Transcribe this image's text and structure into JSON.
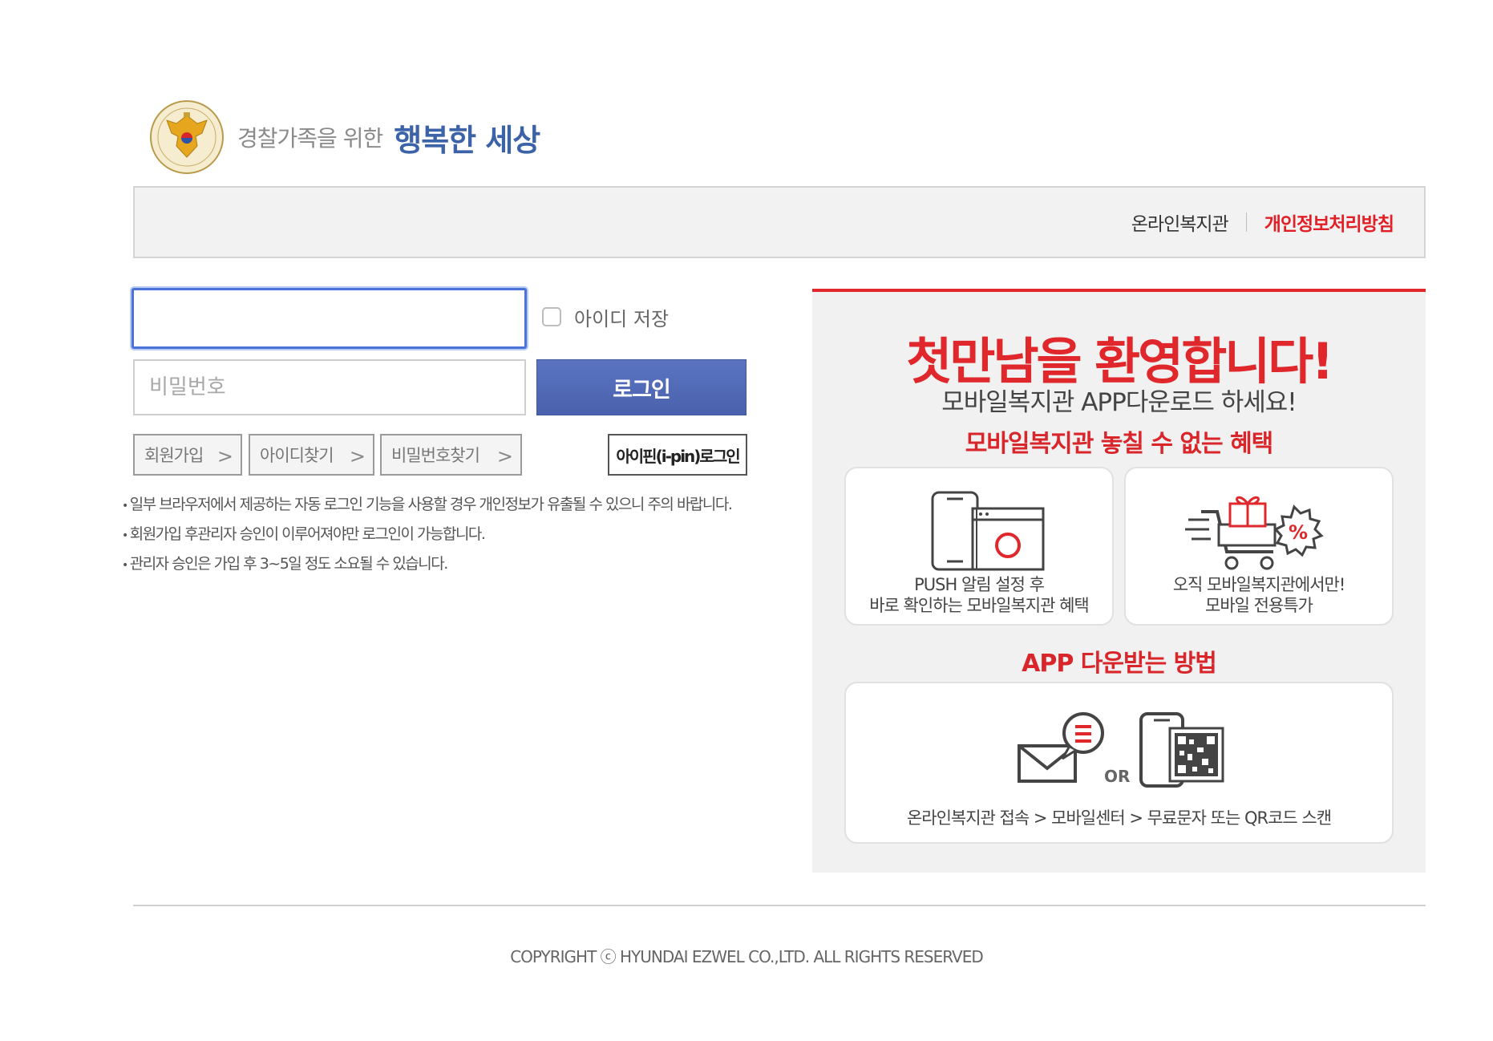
{
  "header": {
    "logo_subtitle": "경찰가족을 위한",
    "logo_title": "행복한 세상"
  },
  "topbar": {
    "link_online": "온라인복지관",
    "link_privacy": "개인정보처리방침"
  },
  "login": {
    "id_value": "",
    "save_id_label": "아이디 저장",
    "password_placeholder": "비밀번호",
    "login_button": "로그인",
    "signup_button": "회원가입",
    "find_id_button": "아이디찾기",
    "find_pw_button": "비밀번호찾기",
    "ipin_button": "아이핀(i-pin)로그인",
    "notices": [
      "일부 브라우저에서 제공하는 자동 로그인 기능을 사용할 경우 개인정보가 유출될 수 있으니 주의 바랍니다.",
      "회원가입 후관리자 승인이 이루어져야만 로그인이 가능합니다.",
      "관리자 승인은 가입 후 3~5일 정도 소요될 수 있습니다."
    ]
  },
  "promo": {
    "title": "첫만남을 환영합니다!",
    "subtitle": "모바일복지관 APP다운로드 하세요!",
    "benefits_heading": "모바일복지관 놓칠 수 없는 혜택",
    "card1_line1": "PUSH 알림 설정 후",
    "card1_line2": "바로 확인하는 모바일복지관 혜택",
    "card2_line1": "오직 모바일복지관에서만!",
    "card2_line2": "모바일 전용특가",
    "percent_symbol": "%",
    "download_heading": "APP 다운받는 방법",
    "or_label": "OR",
    "download_steps": "온라인복지관 접속 > 모바일센터 > 무료문자 또는 QR코드 스캔"
  },
  "footer": {
    "copyright": "COPYRIGHT ⓒ HYUNDAI EZWEL CO.,LTD. ALL RIGHTS RESERVED"
  },
  "colors": {
    "accent_red": "#e0282c",
    "login_blue": "#4a62ad",
    "logo_blue": "#3c63a8"
  }
}
